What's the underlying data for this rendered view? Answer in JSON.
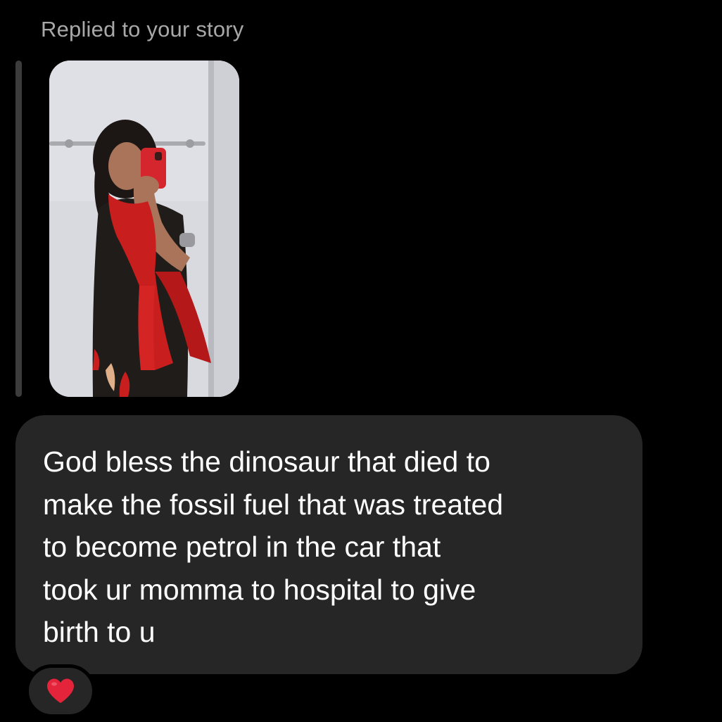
{
  "reply": {
    "label": "Replied to your story"
  },
  "story": {
    "thumbnail_description": "mirror-selfie-photo"
  },
  "message": {
    "text": "God bless the dinosaur that died to\nmake the fossil fuel that was treated\nto become petrol in the car that\ntook ur momma to hospital to give\nbirth to u"
  },
  "reaction": {
    "icon": "red-heart-icon",
    "color": "#e3243b"
  },
  "colors": {
    "background": "#000000",
    "bubble": "#262626",
    "label": "#a8a8a8",
    "text": "#ffffff"
  }
}
